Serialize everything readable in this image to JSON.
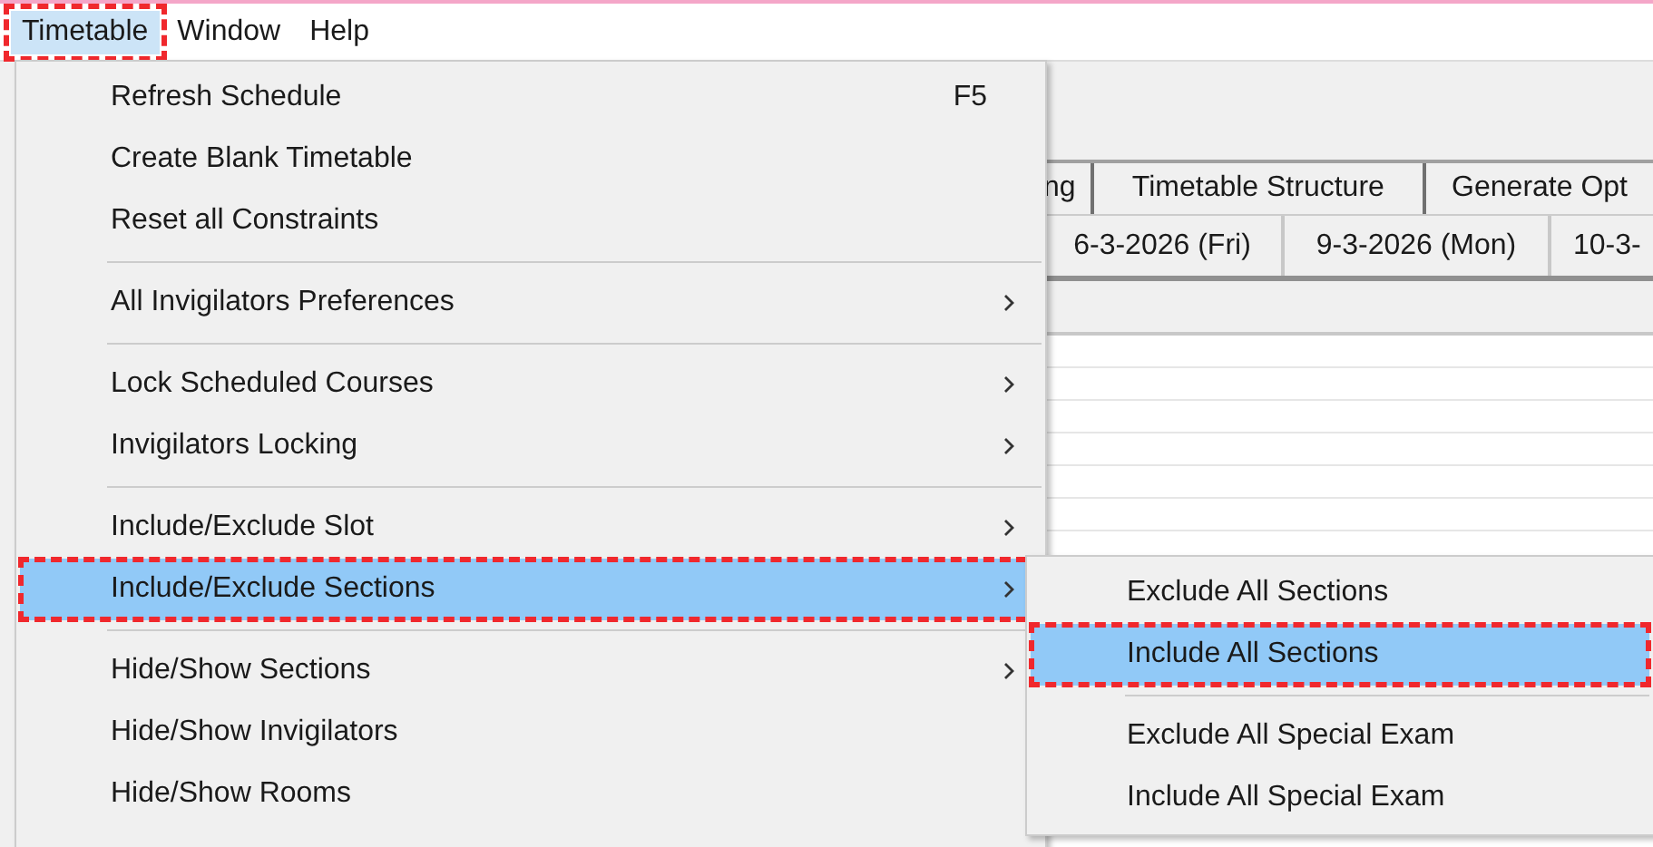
{
  "menubar": [
    {
      "label": "Timetable",
      "selected": true
    },
    {
      "label": "Window",
      "selected": false
    },
    {
      "label": "Help",
      "selected": false
    }
  ],
  "tabs": [
    {
      "label": "ng"
    },
    {
      "label": "Timetable Structure"
    },
    {
      "label": "Generate Opt"
    }
  ],
  "dates": [
    "6-3-2026 (Fri)",
    "9-3-2026 (Mon)",
    "10-3-"
  ],
  "menu": {
    "items": [
      {
        "kind": "item",
        "label": "Refresh Schedule",
        "shortcut": "F5",
        "submenu": false,
        "selected": false
      },
      {
        "kind": "item",
        "label": "Create Blank Timetable",
        "submenu": false,
        "selected": false
      },
      {
        "kind": "item",
        "label": "Reset all Constraints",
        "submenu": false,
        "selected": false
      },
      {
        "kind": "separator"
      },
      {
        "kind": "item",
        "label": "All Invigilators Preferences",
        "submenu": true,
        "selected": false
      },
      {
        "kind": "separator"
      },
      {
        "kind": "item",
        "label": "Lock Scheduled Courses",
        "submenu": true,
        "selected": false
      },
      {
        "kind": "item",
        "label": "Invigilators Locking",
        "submenu": true,
        "selected": false
      },
      {
        "kind": "separator"
      },
      {
        "kind": "item",
        "label": "Include/Exclude Slot",
        "submenu": true,
        "selected": false
      },
      {
        "kind": "item",
        "label": "Include/Exclude Sections",
        "submenu": true,
        "selected": true
      },
      {
        "kind": "separator"
      },
      {
        "kind": "item",
        "label": "Hide/Show Sections",
        "submenu": true,
        "selected": false
      },
      {
        "kind": "item",
        "label": "Hide/Show Invigilators",
        "submenu": false,
        "selected": false
      },
      {
        "kind": "item",
        "label": "Hide/Show Rooms",
        "submenu": false,
        "selected": false
      }
    ]
  },
  "submenu": {
    "items": [
      {
        "kind": "item",
        "label": "Exclude All Sections",
        "selected": false
      },
      {
        "kind": "item",
        "label": "Include All Sections",
        "selected": true
      },
      {
        "kind": "separator"
      },
      {
        "kind": "item",
        "label": "Exclude All Special Exam",
        "selected": false
      },
      {
        "kind": "item",
        "label": "Include All Special Exam",
        "selected": false
      }
    ]
  }
}
